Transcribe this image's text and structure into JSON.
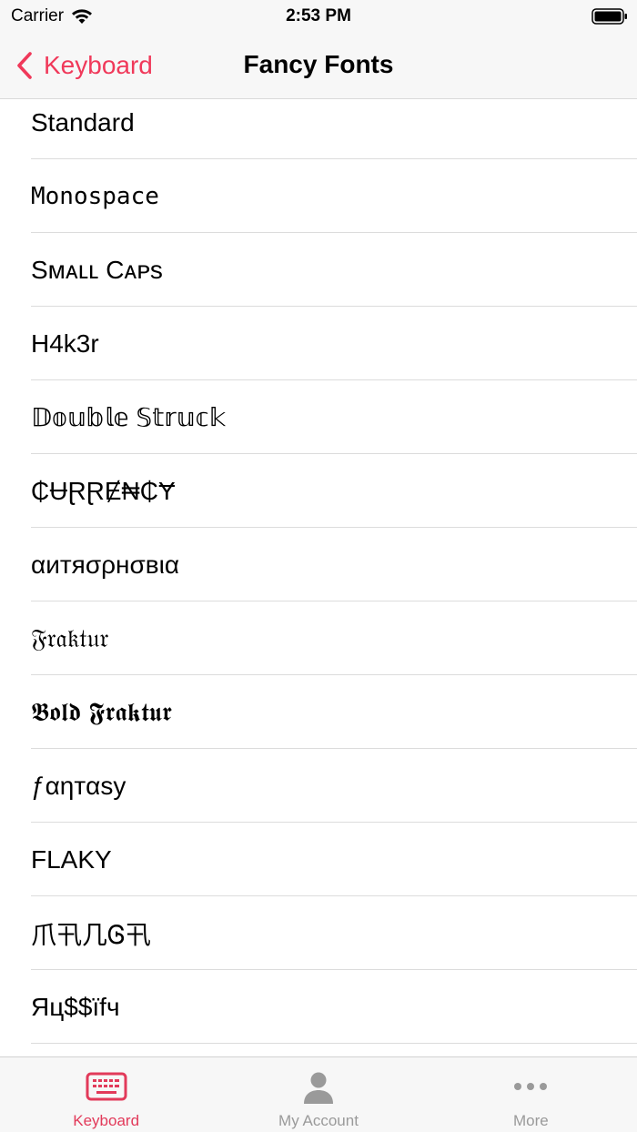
{
  "status_bar": {
    "carrier": "Carrier",
    "time": "2:53 PM"
  },
  "nav": {
    "back_label": "Keyboard",
    "title": "Fancy Fonts"
  },
  "fonts": [
    {
      "label": "Standard",
      "style": "normal"
    },
    {
      "label": "Monospace",
      "style": "mono"
    },
    {
      "label": "Sᴍᴀʟʟ Cᴀᴘs",
      "style": "normal"
    },
    {
      "label": "H4k3r",
      "style": "normal"
    },
    {
      "label": "𝔻𝕠𝕦𝕓𝕝𝕖 𝕊𝕥𝕣𝕦𝕔𝕜",
      "style": "normal"
    },
    {
      "label": "₵ɄⱤⱤɆ₦₵Ɏ",
      "style": "normal"
    },
    {
      "label": "αитяσρнσвια",
      "style": "normal"
    },
    {
      "label": "𝔉𝔯𝔞𝔨𝔱𝔲𝔯",
      "style": "normal"
    },
    {
      "label": "𝕭𝖔𝖑𝖉 𝕱𝖗𝖆𝖐𝖙𝖚𝖗",
      "style": "normal"
    },
    {
      "label": "ƒαηтαѕу",
      "style": "normal"
    },
    {
      "label": "FLAKY",
      "style": "normal"
    },
    {
      "label": "爪卂几Ꮆ卂",
      "style": "normal"
    },
    {
      "label": "Яц$$ïfч",
      "style": "normal"
    }
  ],
  "tabs": [
    {
      "label": "Keyboard",
      "icon": "keyboard-icon",
      "active": true
    },
    {
      "label": "My Account",
      "icon": "person-icon",
      "active": false
    },
    {
      "label": "More",
      "icon": "ellipsis-icon",
      "active": false
    }
  ],
  "colors": {
    "accent": "#f0395a",
    "tab_inactive": "#9a9a9a",
    "bar_background": "#f7f7f7"
  }
}
